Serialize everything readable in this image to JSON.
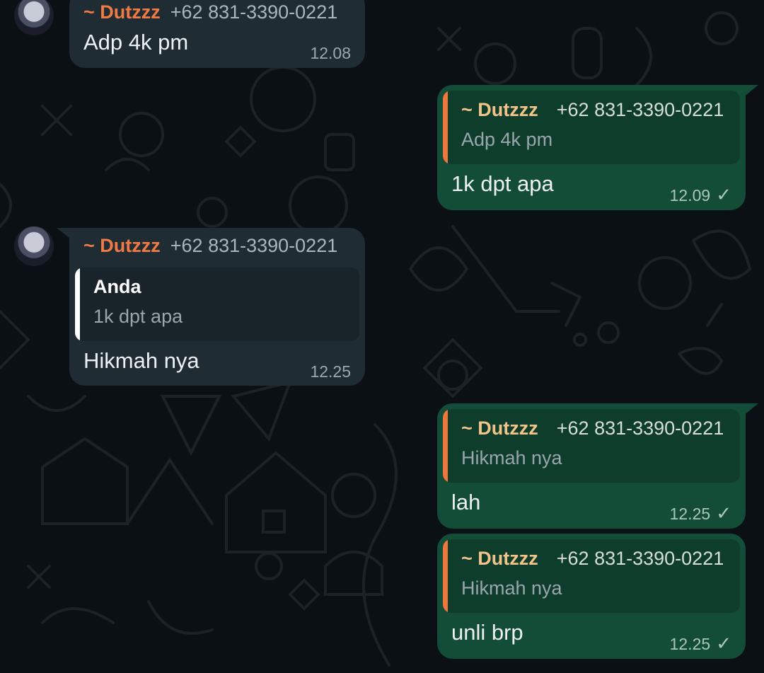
{
  "theme": {
    "background": "#0b1014",
    "incoming_bubble": "#1f2c34",
    "outgoing_bubble": "#134d37",
    "sender_color": "#ef7a44",
    "quote_bar_orange": "#f0773c",
    "quote_bar_white": "#ffffff",
    "read_tick_icon": "check-icon"
  },
  "messages": [
    {
      "sender_name": "~ Dutzzz",
      "sender_phone": "+62 831-3390-0221",
      "text": "Adp 4k pm",
      "time": "12.08"
    },
    {
      "quote": {
        "name": "~ Dutzzz",
        "phone": "+62 831-3390-0221",
        "text": "Adp 4k pm"
      },
      "text": "1k dpt apa",
      "time": "12.09",
      "tick": "✓"
    },
    {
      "sender_name": "~ Dutzzz",
      "sender_phone": "+62 831-3390-0221",
      "quote": {
        "name": "Anda",
        "text": "1k dpt apa"
      },
      "text": "Hikmah nya",
      "time": "12.25"
    },
    {
      "quote": {
        "name": "~ Dutzzz",
        "phone": "+62 831-3390-0221",
        "text": "Hikmah nya"
      },
      "text": "lah",
      "time": "12.25",
      "tick": "✓"
    },
    {
      "quote": {
        "name": "~ Dutzzz",
        "phone": "+62 831-3390-0221",
        "text": "Hikmah nya"
      },
      "text": "unli brp",
      "time": "12.25",
      "tick": "✓"
    }
  ]
}
